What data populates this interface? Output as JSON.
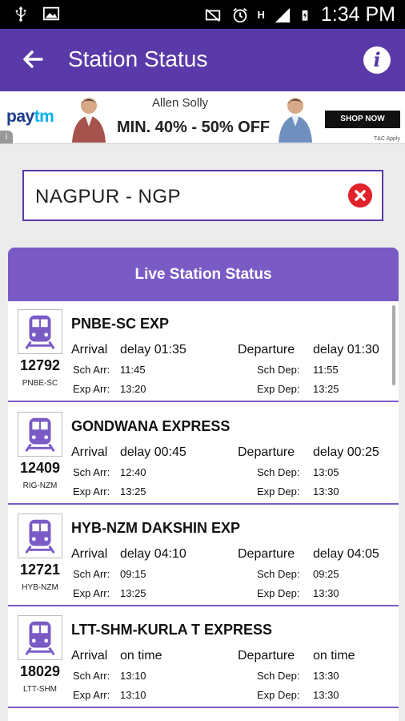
{
  "status_bar": {
    "time": "1:34 PM",
    "network": "H"
  },
  "app_bar": {
    "title": "Station Status"
  },
  "ad": {
    "logo_pay": "pay",
    "logo_tm": "tm",
    "brand": "Allen Solly",
    "offer": "MIN. 40% - 50% OFF",
    "cta": "SHOP NOW",
    "terms": "T&C Apply",
    "info": "i"
  },
  "search": {
    "value": "NAGPUR - NGP"
  },
  "panel": {
    "title": "Live Station Status"
  },
  "labels": {
    "arrival": "Arrival",
    "departure": "Departure",
    "sch_arr": "Sch Arr:",
    "sch_dep": "Sch Dep:",
    "exp_arr": "Exp Arr:",
    "exp_dep": "Exp Dep:"
  },
  "trains": [
    {
      "number": "12792",
      "code": "PNBE-SC",
      "name": "PNBE-SC EXP",
      "arrival_status": "delay 01:35",
      "departure_status": "delay 01:30",
      "sch_arr": "11:45",
      "sch_dep": "11:55",
      "exp_arr": "13:20",
      "exp_dep": "13:25"
    },
    {
      "number": "12409",
      "code": "RIG-NZM",
      "name": "GONDWANA EXPRESS",
      "arrival_status": "delay 00:45",
      "departure_status": "delay 00:25",
      "sch_arr": "12:40",
      "sch_dep": "13:05",
      "exp_arr": "13:25",
      "exp_dep": "13:30"
    },
    {
      "number": "12721",
      "code": "HYB-NZM",
      "name": "HYB-NZM DAKSHIN EXP",
      "arrival_status": "delay 04:10",
      "departure_status": "delay 04:05",
      "sch_arr": "09:15",
      "sch_dep": "09:25",
      "exp_arr": "13:25",
      "exp_dep": "13:30"
    },
    {
      "number": "18029",
      "code": "LTT-SHM",
      "name": "LTT-SHM-KURLA T EXPRESS",
      "arrival_status": "on time",
      "departure_status": "on time",
      "sch_arr": "13:10",
      "sch_dep": "13:30",
      "exp_arr": "13:10",
      "exp_dep": "13:30"
    }
  ],
  "colors": {
    "primary": "#5a3aa8",
    "header": "#7a5bc6",
    "clear": "#e2222a"
  }
}
